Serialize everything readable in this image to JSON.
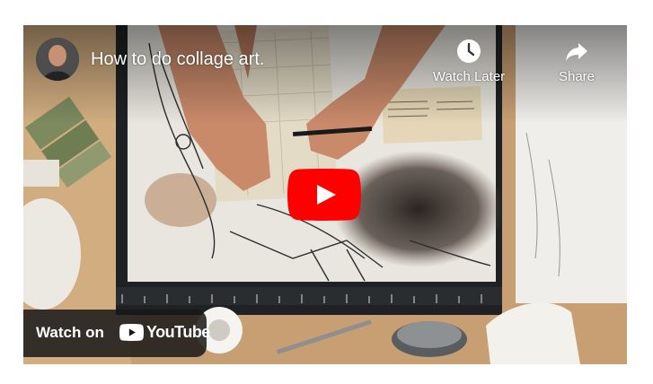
{
  "video": {
    "title": "How to do collage art.",
    "channel_avatar": "channel-avatar"
  },
  "controls": {
    "watch_later_label": "Watch Later",
    "share_label": "Share"
  },
  "watch_on": {
    "label": "Watch on",
    "brand": "YouTube"
  },
  "icons": [
    "clock-icon",
    "share-arrow-icon",
    "play-icon",
    "youtube-logo-icon"
  ],
  "colors": {
    "play_red": "#ff0000",
    "overlay_text": "#ffffff",
    "watch_on_bg": "#171717"
  }
}
